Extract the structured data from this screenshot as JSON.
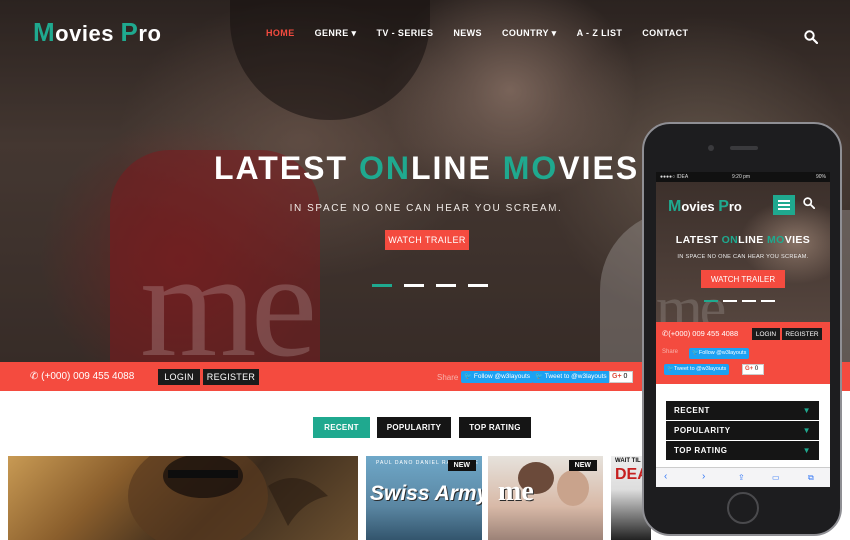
{
  "brand": {
    "logo_m": "M",
    "logo_ovies": "ovies ",
    "logo_p": "P",
    "logo_ro": "ro"
  },
  "nav": [
    "HOME",
    "GENRE ▾",
    "TV - SERIES",
    "NEWS",
    "COUNTRY ▾",
    "A - Z LIST",
    "CONTACT"
  ],
  "hero": {
    "title_a": "LATEST ",
    "title_on": "ON",
    "title_b": "LINE ",
    "title_mo": "MO",
    "title_c": "VIES",
    "subtitle": "IN SPACE NO ONE CAN HEAR YOU SCREAM.",
    "cta": "WATCH TRAILER",
    "watermark": "me"
  },
  "bar": {
    "phone": "(+000) 009 455 4088",
    "login": "LOGIN",
    "register": "REGISTER",
    "share": "Share",
    "follow": "Follow @w3layouts",
    "tweet": "Tweet to @w3layouts",
    "gplus": "G+",
    "gplus_count": "0"
  },
  "tabs": [
    "RECENT",
    "POPULARITY",
    "TOP RATING"
  ],
  "posters": {
    "new_label": "NEW",
    "p2_names": "PAUL DANO    DANIEL RADCLIFFE",
    "p2_title": "Swiss Army Man",
    "p3_title": "me",
    "p4_wait": "WAIT TIL",
    "p4_title": "DEA"
  },
  "mobile": {
    "carrier": "●●●●○ IDEA",
    "time": "9:20 pm",
    "battery": "90%",
    "title_a": "LATEST ",
    "title_on": "ON",
    "title_b": "LINE ",
    "title_mo": "MO",
    "title_c": "VIES",
    "subtitle": "IN SPACE NO ONE CAN HEAR YOU SCREAM.",
    "cta": "WATCH TRAILER",
    "dropdowns": [
      "RECENT",
      "POPULARITY",
      "TOP RATING"
    ],
    "arrow": "▼"
  },
  "colors": {
    "accent": "#1fa98f",
    "red": "#f44b3f",
    "dark": "#151515"
  }
}
